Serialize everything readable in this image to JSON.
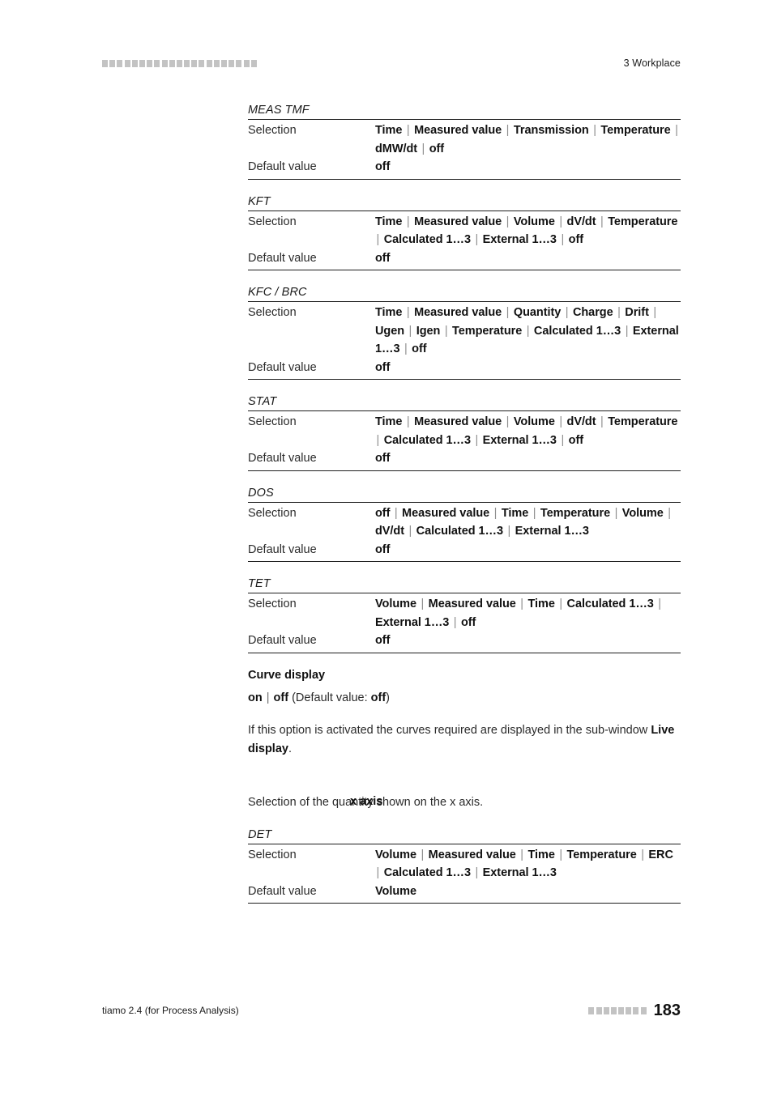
{
  "header": {
    "marker_squares": 21,
    "title": "3 Workplace"
  },
  "footer": {
    "product": "tiamo 2.4 (for Process Analysis)",
    "marker_squares": 8,
    "page_number": "183"
  },
  "labels": {
    "selection": "Selection",
    "default_value": "Default value"
  },
  "tables": [
    {
      "caption": "MEAS TMF",
      "selection": "Time | Measured value | Transmission | Temperature | dMW/dt | off",
      "default": "off"
    },
    {
      "caption": "KFT",
      "selection": "Time | Measured value | Volume | dV/dt | Temperature | Calculated 1…3 | External 1…3 | off",
      "default": "off"
    },
    {
      "caption": "KFC / BRC",
      "selection": "Time | Measured value | Quantity | Charge | Drift | Ugen | Igen | Temperature | Calculated 1…3 | External 1…3 | off",
      "default": "off"
    },
    {
      "caption": "STAT",
      "selection": "Time | Measured value | Volume | dV/dt | Temperature | Calculated 1…3 | External 1…3 | off",
      "default": "off"
    },
    {
      "caption": "DOS",
      "selection": "off | Measured value | Time | Temperature | Volume | dV/dt | Calculated 1…3 | External 1…3",
      "default": "off"
    },
    {
      "caption": "TET",
      "selection": "Volume | Measured value | Time | Calculated 1…3 | External 1…3 | off",
      "default": "off"
    }
  ],
  "curve_display": {
    "heading": "Curve display",
    "options": "on | off",
    "default_note_prefix": " (Default value: ",
    "default_note_value": "off",
    "default_note_suffix": ")",
    "description_part1": "If this option is activated the curves required are displayed in the sub-window ",
    "description_bold": "Live display",
    "description_part2": "."
  },
  "x_axis": {
    "margin_note": "x axis",
    "description": "Selection of the quantity shown on the x axis.",
    "table": {
      "caption": "DET",
      "selection": "Volume | Measured value | Time | Temperature | ERC | Calculated 1…3 | External 1…3",
      "default": "Volume"
    }
  }
}
